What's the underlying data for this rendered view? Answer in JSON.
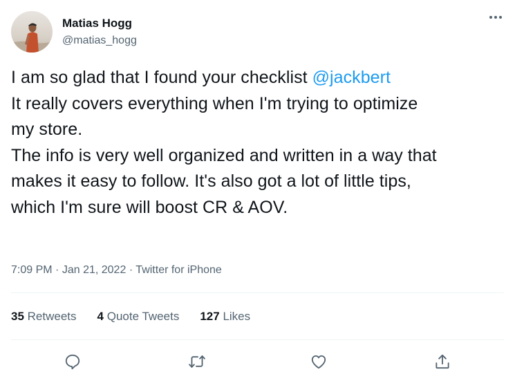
{
  "author": {
    "display_name": "Matias Hogg",
    "handle": "@matias_hogg"
  },
  "tweet": {
    "lines": [
      {
        "text": "I am so glad that I found your checklist ",
        "mention": "@jackbert"
      },
      {
        "text": "It really covers everything when I'm trying to optimize"
      },
      {
        "text": "my store."
      },
      {
        "text": "The info is very well organized and written in a way that"
      },
      {
        "text": "makes it easy to follow. It's also got a lot of little tips,"
      },
      {
        "text": "which I'm sure will boost CR & AOV."
      }
    ]
  },
  "meta": {
    "time": "7:09 PM",
    "separator": "·",
    "date": "Jan 21, 2022",
    "source": "Twitter for iPhone"
  },
  "stats": {
    "retweets_count": "35",
    "retweets_label": "Retweets",
    "quotes_count": "4",
    "quotes_label": "Quote Tweets",
    "likes_count": "127",
    "likes_label": "Likes"
  },
  "actions": [
    "reply-icon",
    "retweet-icon",
    "like-icon",
    "share-icon"
  ],
  "colors": {
    "text": "#0f1419",
    "secondary": "#536471",
    "accent": "#1d9bf0",
    "divider": "#eff3f4"
  }
}
